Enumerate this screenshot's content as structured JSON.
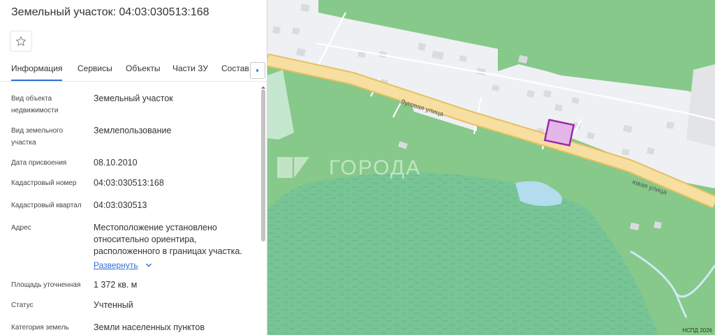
{
  "panel": {
    "title": "Земельный участок: 04:03:030513:168",
    "tabs": [
      {
        "label": "Информация",
        "active": true
      },
      {
        "label": "Сервисы"
      },
      {
        "label": "Объекты"
      },
      {
        "label": "Части ЗУ"
      },
      {
        "label": "Состав"
      }
    ],
    "rows": [
      {
        "label": "Вид объекта недвижимости",
        "value": "Земельный участок"
      },
      {
        "label": "Вид земельного участка",
        "value": "Землепользование"
      },
      {
        "label": "Дата присвоения",
        "value": "08.10.2010"
      },
      {
        "label": "Кадастровый номер",
        "value": "04:03:030513:168"
      },
      {
        "label": "Кадастровый квартал",
        "value": "04:03:030513"
      },
      {
        "label": "Адрес",
        "value": "Местоположение установлено относительно ориентира, расположенного в границах участка.",
        "expand": "Развернуть"
      },
      {
        "label": "Площадь уточненная",
        "value": "1 372 кв. м"
      },
      {
        "label": "Статус",
        "value": "Учтенный"
      },
      {
        "label": "Категория земель",
        "value": "Земли населенных пунктов"
      }
    ]
  },
  "map": {
    "street1": "Луговая улица",
    "street2": "ювая улица",
    "watermark": "ГОРОДА",
    "attribution": "НСПД 2026",
    "colors": {
      "green": "#86c98a",
      "road": "#f6dfa0",
      "road_edge": "#e6bf62",
      "built": "#eef0f3",
      "building": "#d9dcdf",
      "parcel": "#9c2aa8",
      "parcel_fill": "#e4b6e7",
      "water": "#b3dcef"
    }
  }
}
